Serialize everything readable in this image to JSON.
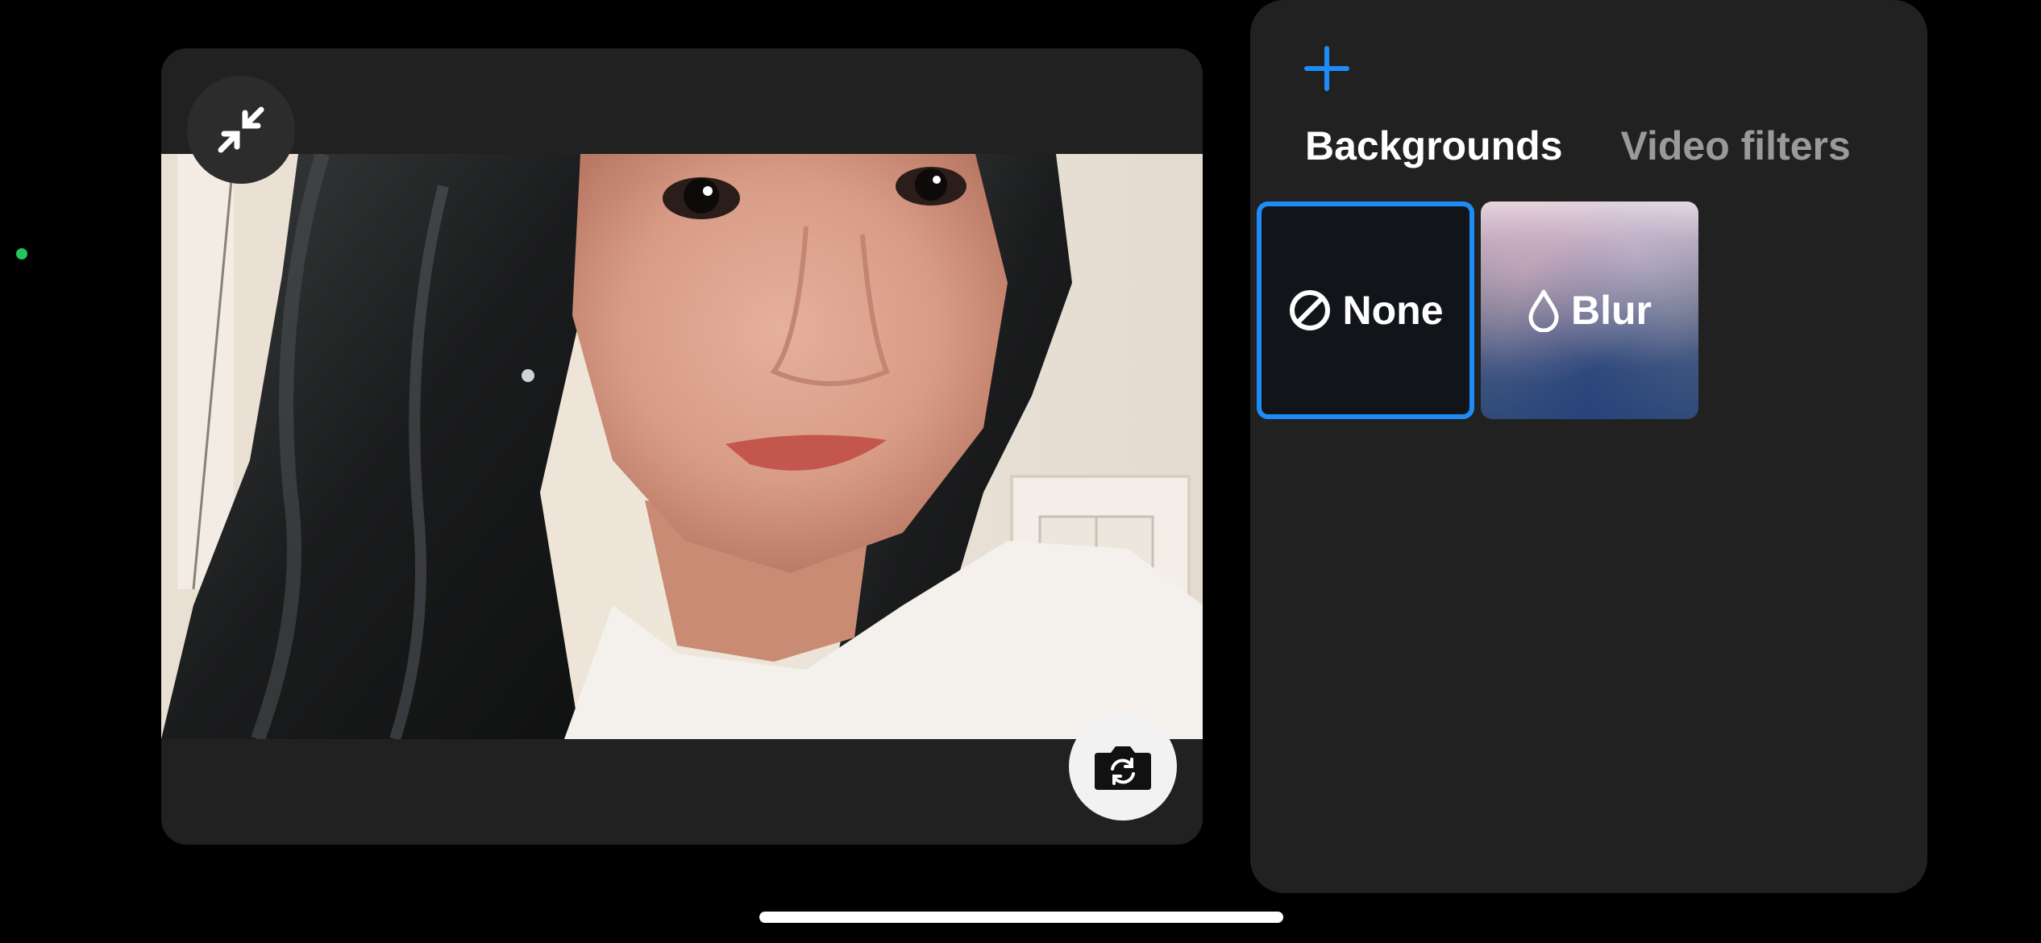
{
  "effects": {
    "tabs": [
      {
        "label": "Backgrounds",
        "active": true
      },
      {
        "label": "Video filters",
        "active": false
      }
    ],
    "tiles": [
      {
        "label": "None",
        "icon": "prohibited-icon",
        "selected": true
      },
      {
        "label": "Blur",
        "icon": "droplet-icon",
        "selected": false
      }
    ],
    "add_icon": "plus-icon"
  },
  "preview": {
    "minimize_icon": "minimize-arrows-icon",
    "flip_icon": "camera-flip-icon"
  },
  "colors": {
    "accent": "#1d8cf8",
    "panel": "#212121",
    "background": "#000000",
    "status_dot": "#22c55e"
  }
}
